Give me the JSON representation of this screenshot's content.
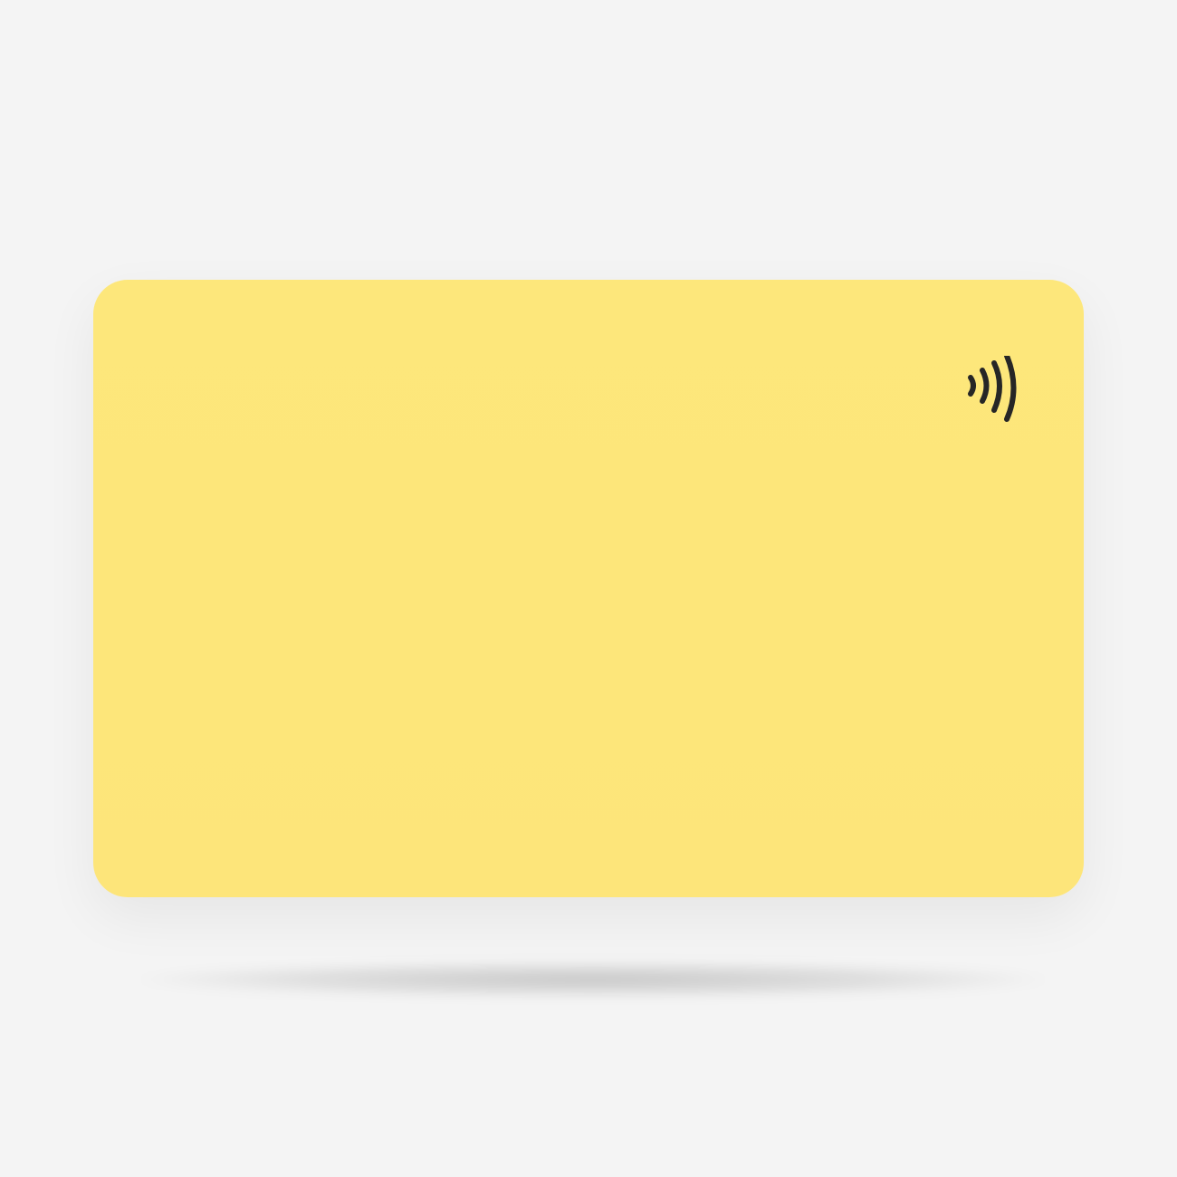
{
  "scene": {
    "background_color": "#f4f4f4"
  },
  "card": {
    "color": "#fde77b",
    "icon": "contactless-icon",
    "icon_color": "#262626"
  }
}
